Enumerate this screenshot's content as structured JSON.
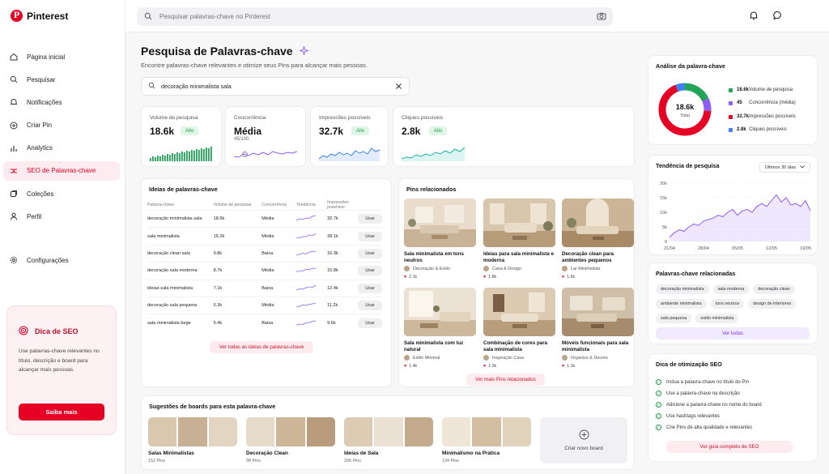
{
  "app": {
    "name": "Pinterest",
    "logo_letter": "P"
  },
  "search": {
    "placeholder": "Pesquisar palavras-chave no Pinterest"
  },
  "sidebar": {
    "items": [
      {
        "label": "Página inicial",
        "icon": "home-icon"
      },
      {
        "label": "Pesquisar",
        "icon": "search-icon"
      },
      {
        "label": "Notificações",
        "icon": "bell-icon"
      },
      {
        "label": "Criar Pin",
        "icon": "plus-circle-icon"
      },
      {
        "label": "Analytics",
        "icon": "bar-chart-icon"
      },
      {
        "label": "SEO de Palavras-chave",
        "icon": "seo-icon",
        "active": true
      },
      {
        "label": "Coleções",
        "icon": "collections-icon"
      },
      {
        "label": "Perfil",
        "icon": "user-icon"
      }
    ],
    "settings": {
      "label": "Configurações",
      "icon": "gear-icon"
    },
    "tip": {
      "title": "Dica de SEO",
      "body": "Use palavras-chave relevantes no título, descrição e board para alcançar mais pessoas.",
      "button": "Saiba mais"
    }
  },
  "page": {
    "title": "Pesquisa de Palavras-chave",
    "subtitle": "Encontre palavras-chave relevantes e otimize seus Pins para alcançar mais pessoas.",
    "keyword_value": "decoração minimalista sala"
  },
  "metrics": [
    {
      "label": "Volume de pesquisa",
      "value": "18.6k",
      "badge": "Alto",
      "color": "#22a559"
    },
    {
      "label": "Concorrência",
      "value": "Média",
      "sub": "45/100",
      "color": "#8b5cf6"
    },
    {
      "label": "Impressões possíveis",
      "value": "32.7k",
      "badge": "Alto",
      "color": "#3b82f6"
    },
    {
      "label": "Cliques possíveis",
      "value": "2.8k",
      "badge": "Alto",
      "color": "#14b8a6"
    }
  ],
  "ideas": {
    "title": "Ideias de palavras-chave",
    "headers": [
      "Palavra-chave",
      "Volume de pesquisa",
      "Concorrência",
      "Tendência",
      "Impressões possíveis",
      ""
    ],
    "rows": [
      {
        "kw": "decoração minimalista sala",
        "vol": "18.6k",
        "comp": "Média",
        "imp": "32.7k",
        "level": "med"
      },
      {
        "kw": "sala minimalista",
        "vol": "16.2k",
        "comp": "Média",
        "imp": "28.1k",
        "level": "med"
      },
      {
        "kw": "decoração clean sala",
        "vol": "9.8k",
        "comp": "Baixa",
        "imp": "16.3k",
        "level": "low"
      },
      {
        "kw": "decoração sala moderna",
        "vol": "8.7k",
        "comp": "Média",
        "imp": "15.8k",
        "level": "med"
      },
      {
        "kw": "ideias sala minimalista",
        "vol": "7.1k",
        "comp": "Baixa",
        "imp": "12.4k",
        "level": "low"
      },
      {
        "kw": "decoração sala pequena",
        "vol": "6.3k",
        "comp": "Média",
        "imp": "11.2k",
        "level": "med"
      },
      {
        "kw": "sala minimalista bege",
        "vol": "5.4k",
        "comp": "Baixa",
        "imp": "9.6k",
        "level": "low"
      }
    ],
    "use_label": "Usar",
    "see_all": "Ver todas as ideias de palavras-chave"
  },
  "pins": {
    "title": "Pins relacionados",
    "items": [
      {
        "title": "Sala minimalista em tons neutros",
        "author": "Decoração & Estilo",
        "likes": "2.1k"
      },
      {
        "title": "Ideias para sala minimalista e moderna",
        "author": "Casa & Design",
        "likes": "1.8k"
      },
      {
        "title": "Decoração clean para ambientes pequenos",
        "author": "Lar Minimalista",
        "likes": "1.6k"
      },
      {
        "title": "Sala minimalista com luz natural",
        "author": "Estilo Minimal",
        "likes": "1.4k"
      },
      {
        "title": "Combinação de cores para sala minimalista",
        "author": "Inspiração Casa",
        "likes": "1.3k"
      },
      {
        "title": "Móveis funcionais para sala minimalista",
        "author": "Organize & Decore",
        "likes": "1.1k"
      }
    ],
    "see_more": "Ver mais Pins relacionados"
  },
  "boards": {
    "title": "Sugestões de boards para esta palavra-chave",
    "items": [
      {
        "name": "Salas Minimalistas",
        "count": "152 Pins"
      },
      {
        "name": "Decoração Clean",
        "count": "98 Pins"
      },
      {
        "name": "Ideias de Sala",
        "count": "206 Pins"
      },
      {
        "name": "Minimalismo na Prática",
        "count": "134 Pins"
      }
    ],
    "create": "Criar novo board"
  },
  "analysis": {
    "title": "Análise da palavra-chave",
    "center_value": "18.6k",
    "center_label": "Total",
    "legend": [
      {
        "value": "18.6k",
        "label": "Volume de pesquisa",
        "color": "#22a559",
        "share": 0.18
      },
      {
        "value": "45",
        "label": "Concorrência (média)",
        "color": "#8b5cf6",
        "share": 0.08
      },
      {
        "value": "32.7k",
        "label": "Impressões possíveis",
        "color": "#e60023",
        "share": 0.68
      },
      {
        "value": "2.8k",
        "label": "Cliques possíveis",
        "color": "#3b82f6",
        "share": 0.06
      }
    ]
  },
  "trend": {
    "title": "Tendência de pesquisa",
    "period": "Últimos 30 dias"
  },
  "chart_data": {
    "type": "area",
    "x": [
      "21/04",
      "22/04",
      "23/04",
      "24/04",
      "25/04",
      "26/04",
      "27/04",
      "28/04",
      "29/04",
      "30/04",
      "01/05",
      "02/05",
      "03/05",
      "04/05",
      "05/05",
      "06/05",
      "07/05",
      "08/05",
      "09/05",
      "10/05",
      "11/05",
      "12/05",
      "13/05",
      "14/05",
      "15/05",
      "16/05",
      "17/05",
      "18/05",
      "19/05",
      "20/05"
    ],
    "xticks": [
      "21/04",
      "28/04",
      "05/05",
      "12/05",
      "19/05"
    ],
    "values": [
      1500,
      3000,
      4000,
      3500,
      5000,
      6000,
      5500,
      7000,
      7500,
      8000,
      9000,
      8500,
      10000,
      11000,
      9000,
      10500,
      11000,
      10000,
      12000,
      13000,
      12000,
      14000,
      16000,
      13500,
      15000,
      12500,
      13000,
      12000,
      14000,
      10500
    ],
    "yticks": [
      "0",
      "5k",
      "10k",
      "15k",
      "20k"
    ],
    "ylim": [
      0,
      20000
    ],
    "color": "#8b5cf6",
    "grid": true
  },
  "related": {
    "title": "Palavras-chave relacionadas",
    "chips": [
      "decoração minimalista",
      "sala moderna",
      "decoração clean",
      "ambiente minimalista",
      "tons neutros",
      "design de interiores",
      "sala pequena",
      "estilo minimalista"
    ],
    "see_all": "Ver todas"
  },
  "optimization": {
    "title": "Dica de otimização SEO",
    "items": [
      "Inclua a palavra-chave no título do Pin",
      "Use a palavra-chave na descrição",
      "Adicione a palavra-chave no nome do board",
      "Use hashtags relevantes",
      "Crie Pins de alta qualidade e relevantes"
    ],
    "button": "Ver guia completo de SEO"
  }
}
